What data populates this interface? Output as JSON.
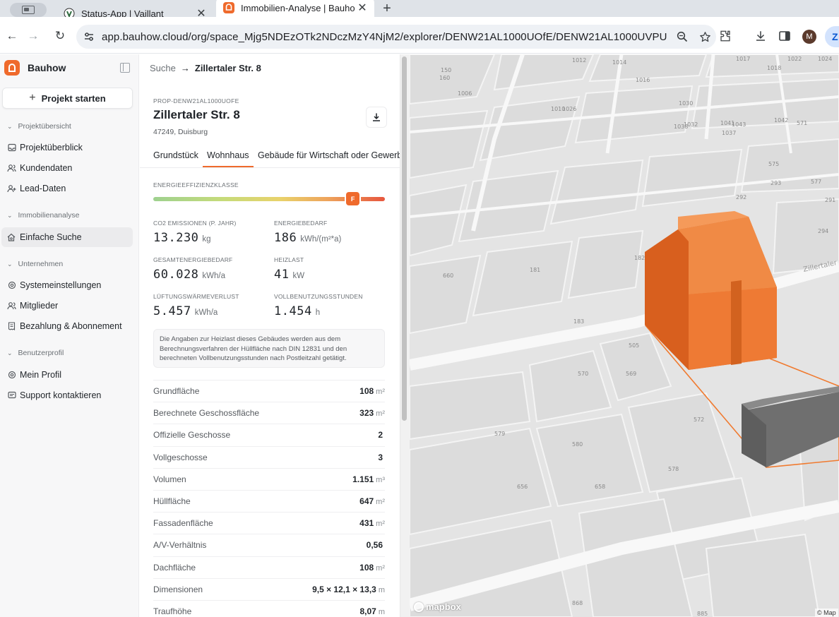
{
  "browser": {
    "tabs": [
      {
        "title": "Status-App | Vaillant",
        "active": false
      },
      {
        "title": "Immobilien-Analyse | Bauhow",
        "active": true
      }
    ],
    "url": "app.bauhow.cloud/org/space_Mjg5NDEzOTk2NDczMzY4NjM2/explorer/DENW21AL1000UOfE/DENW21AL1000UVPU",
    "avatar_letter": "M",
    "profile_label": "Z"
  },
  "sidebar": {
    "brand": "Bauhow",
    "start_project": "Projekt starten",
    "sections": [
      {
        "title": "Projektübersicht",
        "items": [
          "Projektüberblick",
          "Kundendaten",
          "Lead-Daten"
        ]
      },
      {
        "title": "Immobilienanalyse",
        "items": [
          "Einfache Suche"
        ]
      },
      {
        "title": "Unternehmen",
        "items": [
          "Systemeinstellungen",
          "Mitglieder",
          "Bezahlung & Abonnement"
        ]
      },
      {
        "title": "Benutzerprofil",
        "items": [
          "Mein Profil",
          "Support kontaktieren"
        ]
      }
    ],
    "active_item": "Einfache Suche"
  },
  "panel": {
    "breadcrumb": {
      "root": "Suche",
      "current": "Zillertaler Str. 8"
    },
    "property_id": "PROP-DENW21AL1000UOFE",
    "title": "Zillertaler Str. 8",
    "subtitle": "47249, Duisburg",
    "tabs": [
      "Grundstück",
      "Wohnhaus",
      "Gebäude für Wirtschaft oder Gewerbe"
    ],
    "active_tab": "Wohnhaus",
    "efficiency": {
      "label": "ENERGIEEFFIZIENZKLASSE",
      "class": "F",
      "position": 0.86
    },
    "metrics": [
      {
        "label": "CO2 Emissionen (p. Jahr)",
        "value": "13.230",
        "unit": "kg"
      },
      {
        "label": "Energiebedarf",
        "value": "186",
        "unit": "kWh/(m²*a)"
      },
      {
        "label": "Gesamtenergiebedarf",
        "value": "60.028",
        "unit": "kWh/a"
      },
      {
        "label": "Heizlast",
        "value": "41",
        "unit": "kW"
      },
      {
        "label": "Lüftungswärmeverlust",
        "value": "5.457",
        "unit": "kWh/a"
      },
      {
        "label": "Vollbenutzungsstunden",
        "value": "1.454",
        "unit": "h"
      }
    ],
    "info_text": "Die Angaben zur Heizlast dieses Gebäudes werden aus dem Berechnungsverfahren der Hüllfläche nach DIN 12831 und den berechneten Vollbenutzungsstunden nach Postleitzahl getätigt.",
    "rows": [
      {
        "label": "Grundfläche",
        "value": "108",
        "unit": "m²"
      },
      {
        "label": "Berechnete Geschossfläche",
        "value": "323",
        "unit": "m²"
      },
      {
        "label": "Offizielle Geschosse",
        "value": "2",
        "unit": ""
      },
      {
        "label": "Vollgeschosse",
        "value": "3",
        "unit": ""
      },
      {
        "label": "Volumen",
        "value": "1.151",
        "unit": "m³"
      },
      {
        "label": "Hüllfläche",
        "value": "647",
        "unit": "m²"
      },
      {
        "label": "Fassadenfläche",
        "value": "431",
        "unit": "m²"
      },
      {
        "label": "A/V-Verhältnis",
        "value": "0,56",
        "unit": ""
      },
      {
        "label": "Dachfläche",
        "value": "108",
        "unit": "m²"
      },
      {
        "label": "Dimensionen",
        "value": "9,5 × 12,1 × 13,3",
        "unit": "m"
      },
      {
        "label": "Traufhöhe",
        "value": "8,07",
        "unit": "m"
      }
    ]
  },
  "map": {
    "street_label": "Zillertaler",
    "parcel_labels": [
      "150",
      "160",
      "1006",
      "1010",
      "1012",
      "1014",
      "1016",
      "1017",
      "1018",
      "1022",
      "1024",
      "1026",
      "1030",
      "1032",
      "1037",
      "1038",
      "1041",
      "1042",
      "1043",
      "571",
      "575",
      "577",
      "291",
      "292",
      "293",
      "294",
      "660",
      "181",
      "182",
      "183",
      "505",
      "569",
      "570",
      "572",
      "578",
      "579",
      "580",
      "656",
      "658",
      "868",
      "885"
    ],
    "attribution": "© Map",
    "logo_text": "mapbox",
    "colors": {
      "building": "#ee7a34",
      "selected_outline": "#f07a2f",
      "neighbor": "#7a7a7a"
    }
  }
}
